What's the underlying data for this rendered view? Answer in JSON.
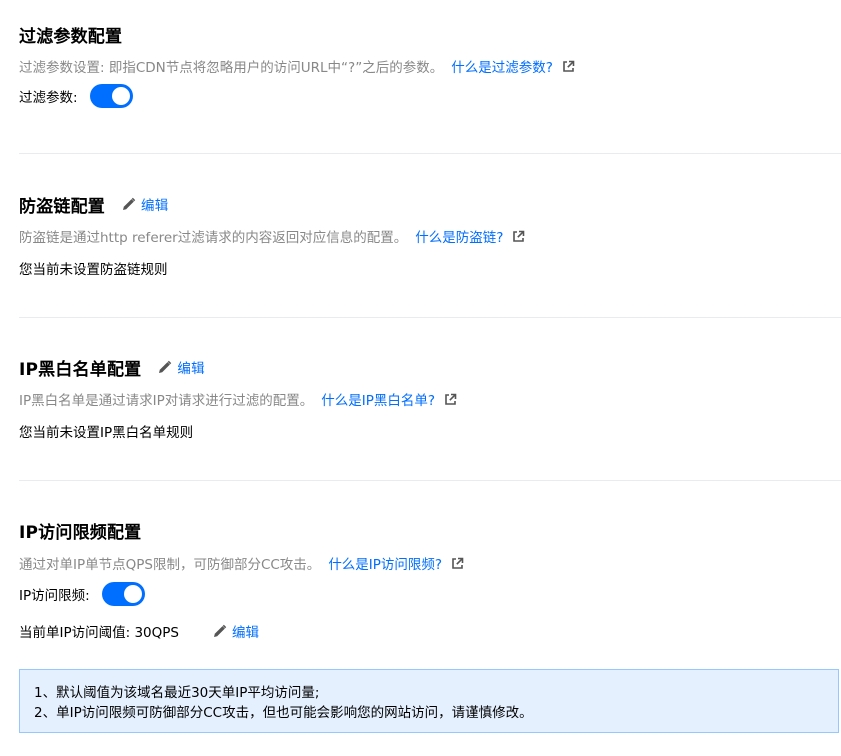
{
  "filter": {
    "title": "过滤参数配置",
    "desc": "过滤参数设置: 即指CDN节点将忽略用户的访问URL中“?”之后的参数。",
    "link": "什么是过滤参数?",
    "toggle_label": "过滤参数:",
    "toggle_on": true
  },
  "referer": {
    "title": "防盗链配置",
    "edit": "编辑",
    "desc": "防盗链是通过http referer过滤请求的内容返回对应信息的配置。",
    "link": "什么是防盗链?",
    "status": "您当前未设置防盗链规则"
  },
  "ip_list": {
    "title": "IP黑白名单配置",
    "edit": "编辑",
    "desc": "IP黑白名单是通过请求IP对请求进行过滤的配置。",
    "link": "什么是IP黑白名单?",
    "status": "您当前未设置IP黑白名单规则"
  },
  "ip_limit": {
    "title": "IP访问限频配置",
    "desc": "通过对单IP单节点QPS限制，可防御部分CC攻击。",
    "link": "什么是IP访问限频?",
    "toggle_label": "IP访问限频:",
    "toggle_on": true,
    "threshold": "当前单IP访问阈值: 30QPS",
    "edit": "编辑"
  },
  "notice": {
    "lines": [
      "1、默认阈值为该域名最近30天单IP平均访问量;",
      "2、单IP访问限频可防御部分CC攻击，但也可能会影响您的网站访问，请谨慎修改。"
    ]
  },
  "colors": {
    "accent": "#006eff",
    "muted_text": "#888888",
    "notice_bg": "#e5f0ff",
    "notice_border": "#97c7ff"
  },
  "icons": {
    "edit": "pencil-icon",
    "external": "external-link-icon"
  }
}
